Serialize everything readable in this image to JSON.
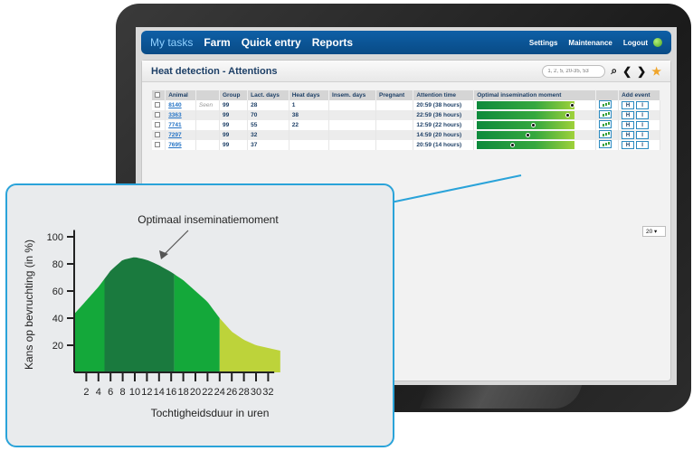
{
  "nav": {
    "items": [
      "My tasks",
      "Farm",
      "Quick entry",
      "Reports"
    ],
    "right": [
      "Settings",
      "Maintenance",
      "Logout"
    ]
  },
  "panel": {
    "title": "Heat detection - Attentions",
    "search_placeholder": "1, 2, 5, 20-35, 53"
  },
  "table": {
    "headers": [
      "",
      "Animal",
      "",
      "Group",
      "Lact. days",
      "Heat days",
      "Insem. days",
      "Pregnant",
      "Attention time",
      "Optimal insemination moment",
      "",
      "Add event"
    ],
    "rows": [
      {
        "animal": "8140",
        "note": "Seen",
        "group": "99",
        "lact": "28",
        "heat": "1",
        "insem": "",
        "pregnant": "",
        "time": "20:59 (38 hours)",
        "moment": 0.98
      },
      {
        "animal": "3363",
        "note": "",
        "group": "99",
        "lact": "70",
        "heat": "38",
        "insem": "",
        "pregnant": "",
        "time": "22:59 (36 hours)",
        "moment": 0.93
      },
      {
        "animal": "7741",
        "note": "",
        "group": "99",
        "lact": "55",
        "heat": "22",
        "insem": "",
        "pregnant": "",
        "time": "12:59 (22 hours)",
        "moment": 0.58
      },
      {
        "animal": "7297",
        "note": "",
        "group": "99",
        "lact": "32",
        "heat": "",
        "insem": "",
        "pregnant": "",
        "time": "14:59 (20 hours)",
        "moment": 0.53
      },
      {
        "animal": "7695",
        "note": "",
        "group": "99",
        "lact": "37",
        "heat": "",
        "insem": "",
        "pregnant": "",
        "time": "20:59 (14 hours)",
        "moment": 0.37
      }
    ],
    "event_h": "H",
    "event_i": "I"
  },
  "pager": {
    "value": "20"
  },
  "colors": {
    "nav": "#0e5fa6",
    "accent": "#2aa3d9",
    "green_dark": "#1a7a3e",
    "green": "#14a83a",
    "lime": "#bdd33a"
  },
  "chart_data": {
    "type": "area",
    "title": "Optimaal inseminatiemoment",
    "xlabel": "Tochtigheidsduur in uren",
    "ylabel": "Kans op bevruchting (in %)",
    "x": [
      0,
      2,
      4,
      6,
      8,
      10,
      12,
      14,
      16,
      18,
      20,
      22,
      24,
      26,
      28,
      30,
      32
    ],
    "y": [
      43,
      53,
      63,
      75,
      83,
      85,
      83,
      79,
      74,
      68,
      60,
      52,
      40,
      30,
      24,
      20,
      18
    ],
    "xticks": [
      "2",
      "4",
      "6",
      "8",
      "10",
      "12",
      "14",
      "16",
      "18",
      "20",
      "22",
      "24",
      "26",
      "28",
      "30",
      "32"
    ],
    "yticks": [
      "20",
      "40",
      "60",
      "80",
      "100"
    ],
    "ylim": [
      0,
      100
    ],
    "segments": [
      {
        "from": 0,
        "to": 5,
        "color": "#14a83a"
      },
      {
        "from": 5,
        "to": 16.5,
        "color": "#1a7a3e"
      },
      {
        "from": 16.5,
        "to": 24,
        "color": "#14a83a"
      },
      {
        "from": 24,
        "to": 34,
        "color": "#bdd33a"
      }
    ]
  }
}
